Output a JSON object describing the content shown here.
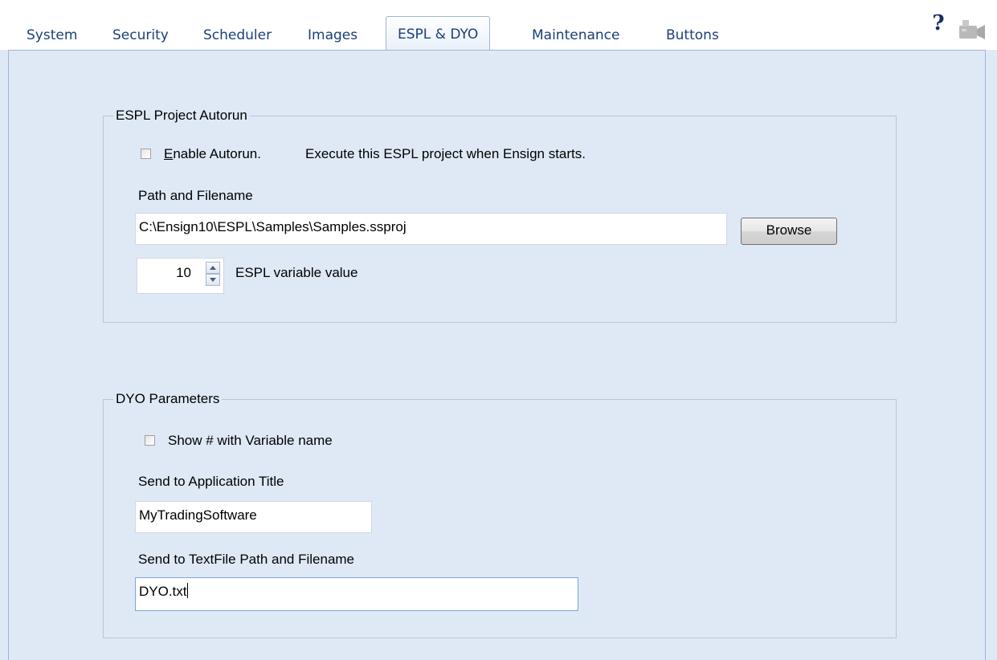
{
  "tabs": [
    {
      "label": "System",
      "active": false
    },
    {
      "label": "Security",
      "active": false
    },
    {
      "label": "Scheduler",
      "active": false
    },
    {
      "label": "Images",
      "active": false
    },
    {
      "label": "ESPL & DYO",
      "active": true
    },
    {
      "label": "Maintenance",
      "active": false
    },
    {
      "label": "Buttons",
      "active": false
    }
  ],
  "toolbar": {
    "help_icon_glyph": "?",
    "help_icon": "help-icon",
    "camera_icon": "camera-icon"
  },
  "espl": {
    "legend": "ESPL Project Autorun",
    "enable_checkbox": {
      "label": "Enable Autorun.",
      "checked": false
    },
    "enable_description": "Execute this ESPL project when Ensign starts.",
    "path_label": "Path and Filename",
    "path_value": "C:\\Ensign10\\ESPL\\Samples\\Samples.ssproj",
    "browse_label": "Browse",
    "variable_value": "10",
    "variable_label": "ESPL variable value"
  },
  "dyo": {
    "legend": "DYO Parameters",
    "show_checkbox": {
      "label": "Show # with Variable name",
      "checked": false
    },
    "app_title_label": "Send to Application Title",
    "app_title_value": "MyTradingSoftware",
    "textfile_label": "Send to TextFile Path and Filename",
    "textfile_value": "DYO.txt"
  },
  "colors": {
    "panel_background": "#dfe9f6",
    "tab_text": "#1a3f7a"
  }
}
